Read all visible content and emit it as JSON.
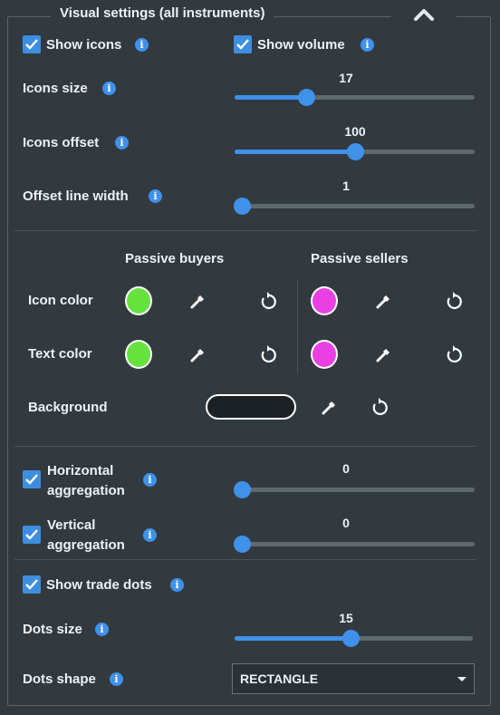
{
  "panel": {
    "title": "Visual settings (all instruments)"
  },
  "show_icons": {
    "label": "Show icons",
    "checked": true
  },
  "show_volume": {
    "label": "Show volume",
    "checked": true
  },
  "icons_size": {
    "label": "Icons size",
    "value": "17",
    "fraction": 0.3
  },
  "icons_offset": {
    "label": "Icons offset",
    "value": "100",
    "fraction": 0.5
  },
  "offset_line_width": {
    "label": "Offset line width",
    "value": "1",
    "fraction": 0.0
  },
  "colors": {
    "col_buyers": "Passive buyers",
    "col_sellers": "Passive sellers",
    "icon_color_label": "Icon color",
    "text_color_label": "Text color",
    "background_label": "Background",
    "buyers_icon_color": "#66e23f",
    "buyers_text_color": "#66e23f",
    "sellers_icon_color": "#ea3fe3",
    "sellers_text_color": "#ea3fe3",
    "background_color": "#1c2126"
  },
  "horizontal_aggregation": {
    "label_line1": "Horizontal",
    "label_line2": "aggregation",
    "value": "0",
    "checked": true,
    "fraction": 0.0
  },
  "vertical_aggregation": {
    "label_line1": "Vertical",
    "label_line2": "aggregation",
    "value": "0",
    "checked": true,
    "fraction": 0.0
  },
  "show_trade_dots": {
    "label": "Show trade dots",
    "checked": true
  },
  "dots_size": {
    "label": "Dots size",
    "value": "15",
    "fraction": 0.49
  },
  "dots_shape": {
    "label": "Dots shape",
    "selected": "RECTANGLE"
  },
  "theme": {
    "accent": "#3f91ea",
    "background": "#323a40"
  },
  "icons": [
    "chevron-up-icon",
    "check-icon",
    "info-icon",
    "eyedropper-icon",
    "reset-icon",
    "dropdown-caret-icon"
  ]
}
